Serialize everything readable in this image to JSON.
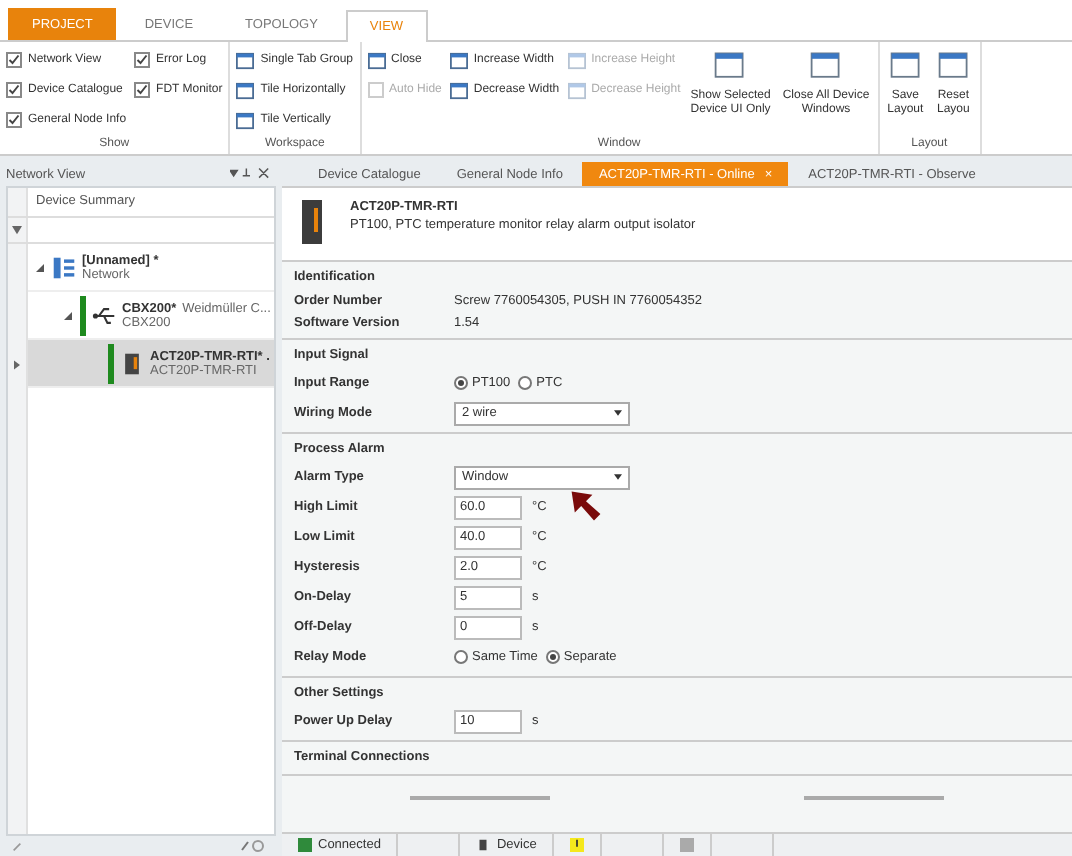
{
  "ribbon_tabs": [
    {
      "label": "PROJECT",
      "kind": "file",
      "selected": false
    },
    {
      "label": "DEVICE",
      "kind": "tab",
      "selected": false
    },
    {
      "label": "TOPOLOGY",
      "kind": "tab",
      "selected": false
    },
    {
      "label": "VIEW",
      "kind": "tab",
      "selected": true
    }
  ],
  "ribbon_groups": [
    {
      "label": "Show",
      "columns": [
        [
          {
            "kind": "checkbox",
            "label": "Network View",
            "checked": true,
            "disabled": false
          },
          {
            "kind": "checkbox",
            "label": "Device Catalogue",
            "checked": true,
            "disabled": false
          },
          {
            "kind": "checkbox",
            "label": "General Node Info",
            "checked": true,
            "disabled": false
          }
        ],
        [
          {
            "kind": "checkbox",
            "label": "Error Log",
            "checked": true,
            "disabled": false
          },
          {
            "kind": "checkbox",
            "label": "FDT Monitor",
            "checked": true,
            "disabled": false
          }
        ]
      ]
    },
    {
      "label": "Workspace",
      "columns": [
        [
          {
            "kind": "button",
            "label": "Single Tab Group",
            "disabled": false
          },
          {
            "kind": "button",
            "label": "Tile Horizontally",
            "disabled": false
          },
          {
            "kind": "button",
            "label": "Tile Vertically",
            "disabled": false
          }
        ]
      ]
    },
    {
      "label": "Window",
      "columns": [
        [
          {
            "kind": "button",
            "label": "Close",
            "disabled": false
          },
          {
            "kind": "checkbox",
            "label": "Auto Hide",
            "checked": false,
            "disabled": true
          }
        ],
        [
          {
            "kind": "button",
            "label": "Increase Width",
            "disabled": false
          },
          {
            "kind": "button",
            "label": "Decrease Width",
            "disabled": false
          }
        ],
        [
          {
            "kind": "button",
            "label": "Increase Height",
            "disabled": true
          },
          {
            "kind": "button",
            "label": "Decrease Height",
            "disabled": true
          }
        ],
        [
          {
            "kind": "large",
            "lines": [
              "Show Selected",
              "Device UI Only"
            ],
            "disabled": false
          }
        ],
        [
          {
            "kind": "large",
            "lines": [
              "Close All Device",
              "Windows"
            ],
            "disabled": false
          }
        ]
      ]
    },
    {
      "label": "Layout",
      "columns": [
        [
          {
            "kind": "large",
            "lines": [
              "Save",
              "Layout"
            ],
            "disabled": false
          }
        ],
        [
          {
            "kind": "large",
            "lines": [
              "Reset",
              "Layou"
            ],
            "disabled": false
          }
        ]
      ]
    }
  ],
  "network_view": {
    "title": "Network View",
    "column": "Device Summary",
    "tree": [
      {
        "kind": "network",
        "name": "[Unnamed] *",
        "sub": "Network",
        "expanded": true,
        "selected": false,
        "children": [
          {
            "kind": "gateway",
            "name": "CBX200*",
            "vendor": "Weidmüller C...",
            "sub": "CBX200",
            "expanded": true,
            "selected": false,
            "children": [
              {
                "kind": "module",
                "name": "ACT20P-TMR-RTI* .",
                "sub": "ACT20P-TMR-RTI",
                "expanded": false,
                "selected": true
              }
            ]
          }
        ]
      }
    ]
  },
  "doc_tabs": [
    {
      "label": "Device Catalogue",
      "selected": false
    },
    {
      "label": "General Node Info",
      "selected": false
    },
    {
      "label": "ACT20P-TMR-RTI - Online",
      "selected": true,
      "close": "×"
    },
    {
      "label": "ACT20P-TMR-RTI - Observe",
      "selected": false
    }
  ],
  "device": {
    "name": "ACT20P-TMR-RTI",
    "description": "PT100, PTC temperature monitor relay alarm output isolator"
  },
  "sections": [
    {
      "title": "Identification",
      "rows": [
        {
          "kind": "text",
          "label": "Order Number",
          "value": "Screw 7760054305, PUSH IN 7760054352"
        },
        {
          "kind": "text",
          "label": "Software Version",
          "value": "1.54"
        }
      ]
    },
    {
      "title": "Input Signal",
      "rows": [
        {
          "kind": "radio",
          "label": "Input Range",
          "options": [
            {
              "label": "PT100",
              "selected": true
            },
            {
              "label": "PTC",
              "selected": false
            }
          ]
        },
        {
          "kind": "select",
          "label": "Wiring Mode",
          "value": "2 wire"
        }
      ]
    },
    {
      "title": "Process Alarm",
      "rows": [
        {
          "kind": "select",
          "label": "Alarm Type",
          "value": "Window"
        },
        {
          "kind": "number",
          "label": "High Limit",
          "value": "60.0",
          "unit": "°C"
        },
        {
          "kind": "number",
          "label": "Low Limit",
          "value": "40.0",
          "unit": "°C"
        },
        {
          "kind": "number",
          "label": "Hysteresis",
          "value": "2.0",
          "unit": "°C"
        },
        {
          "kind": "number",
          "label": "On-Delay",
          "value": "5",
          "unit": "s"
        },
        {
          "kind": "number",
          "label": "Off-Delay",
          "value": "0",
          "unit": "s"
        },
        {
          "kind": "radio",
          "label": "Relay Mode",
          "options": [
            {
              "label": "Same Time",
              "selected": false
            },
            {
              "label": "Separate",
              "selected": true
            }
          ]
        }
      ]
    },
    {
      "title": "Other Settings",
      "rows": [
        {
          "kind": "number",
          "label": "Power Up Delay",
          "value": "10",
          "unit": "s"
        }
      ]
    },
    {
      "title": "Terminal Connections"
    }
  ],
  "status_bar": {
    "connection": "Connected",
    "device": "Device"
  }
}
